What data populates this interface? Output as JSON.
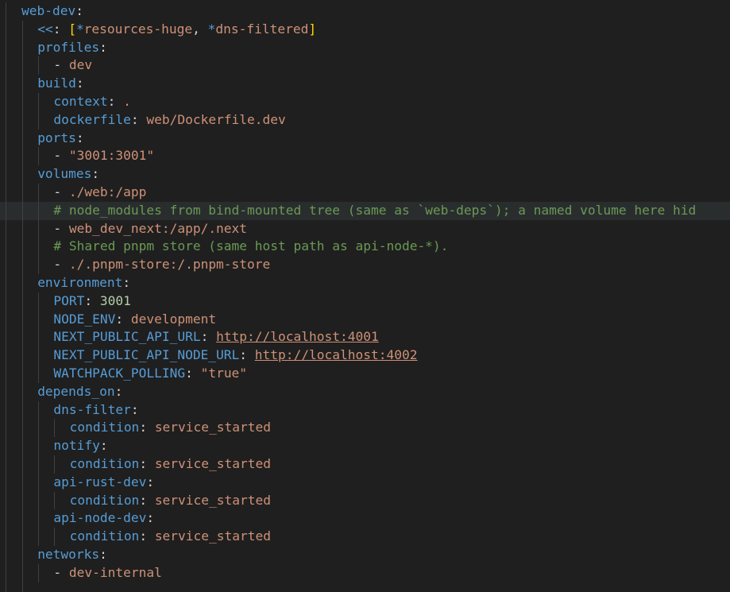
{
  "editor": {
    "lines": [
      {
        "indent": 1,
        "segments": [
          {
            "t": "k",
            "v": "web-dev"
          },
          {
            "t": "p",
            "v": ":"
          }
        ]
      },
      {
        "indent": 2,
        "segments": [
          {
            "t": "k",
            "v": "<<"
          },
          {
            "t": "p",
            "v": ": "
          },
          {
            "t": "b",
            "v": "["
          },
          {
            "t": "k",
            "v": "*"
          },
          {
            "t": "s",
            "v": "resources-huge"
          },
          {
            "t": "p",
            "v": ", "
          },
          {
            "t": "k",
            "v": "*"
          },
          {
            "t": "s",
            "v": "dns-filtered"
          },
          {
            "t": "b",
            "v": "]"
          }
        ]
      },
      {
        "indent": 2,
        "segments": [
          {
            "t": "k",
            "v": "profiles"
          },
          {
            "t": "p",
            "v": ":"
          }
        ]
      },
      {
        "indent": 3,
        "segments": [
          {
            "t": "p",
            "v": "- "
          },
          {
            "t": "s",
            "v": "dev"
          }
        ]
      },
      {
        "indent": 2,
        "segments": [
          {
            "t": "k",
            "v": "build"
          },
          {
            "t": "p",
            "v": ":"
          }
        ]
      },
      {
        "indent": 3,
        "segments": [
          {
            "t": "k",
            "v": "context"
          },
          {
            "t": "p",
            "v": ": "
          },
          {
            "t": "s",
            "v": "."
          }
        ]
      },
      {
        "indent": 3,
        "segments": [
          {
            "t": "k",
            "v": "dockerfile"
          },
          {
            "t": "p",
            "v": ": "
          },
          {
            "t": "s",
            "v": "web/Dockerfile.dev"
          }
        ]
      },
      {
        "indent": 2,
        "segments": [
          {
            "t": "k",
            "v": "ports"
          },
          {
            "t": "p",
            "v": ":"
          }
        ]
      },
      {
        "indent": 3,
        "segments": [
          {
            "t": "p",
            "v": "- "
          },
          {
            "t": "s",
            "v": "\"3001:3001\""
          }
        ]
      },
      {
        "indent": 2,
        "segments": [
          {
            "t": "k",
            "v": "volumes"
          },
          {
            "t": "p",
            "v": ":"
          }
        ]
      },
      {
        "indent": 3,
        "segments": [
          {
            "t": "p",
            "v": "- "
          },
          {
            "t": "s",
            "v": "./web:/app"
          }
        ]
      },
      {
        "indent": 3,
        "highlight": true,
        "segments": [
          {
            "t": "c",
            "v": "# node_modules from bind-mounted tree (same as `web-deps`); a named volume here hid"
          }
        ]
      },
      {
        "indent": 3,
        "segments": [
          {
            "t": "p",
            "v": "- "
          },
          {
            "t": "s",
            "v": "web_dev_next:/app/.next"
          }
        ]
      },
      {
        "indent": 3,
        "segments": [
          {
            "t": "c",
            "v": "# Shared pnpm store (same host path as api-node-*)."
          }
        ]
      },
      {
        "indent": 3,
        "segments": [
          {
            "t": "p",
            "v": "- "
          },
          {
            "t": "s",
            "v": "./.pnpm-store:/.pnpm-store"
          }
        ]
      },
      {
        "indent": 2,
        "segments": [
          {
            "t": "k",
            "v": "environment"
          },
          {
            "t": "p",
            "v": ":"
          }
        ]
      },
      {
        "indent": 3,
        "segments": [
          {
            "t": "k",
            "v": "PORT"
          },
          {
            "t": "p",
            "v": ": "
          },
          {
            "t": "n",
            "v": "3001"
          }
        ]
      },
      {
        "indent": 3,
        "segments": [
          {
            "t": "k",
            "v": "NODE_ENV"
          },
          {
            "t": "p",
            "v": ": "
          },
          {
            "t": "s",
            "v": "development"
          }
        ]
      },
      {
        "indent": 3,
        "segments": [
          {
            "t": "k",
            "v": "NEXT_PUBLIC_API_URL"
          },
          {
            "t": "p",
            "v": ": "
          },
          {
            "t": "u",
            "v": "http://localhost:4001"
          }
        ]
      },
      {
        "indent": 3,
        "segments": [
          {
            "t": "k",
            "v": "NEXT_PUBLIC_API_NODE_URL"
          },
          {
            "t": "p",
            "v": ": "
          },
          {
            "t": "u",
            "v": "http://localhost:4002"
          }
        ]
      },
      {
        "indent": 3,
        "segments": [
          {
            "t": "k",
            "v": "WATCHPACK_POLLING"
          },
          {
            "t": "p",
            "v": ": "
          },
          {
            "t": "s",
            "v": "\"true\""
          }
        ]
      },
      {
        "indent": 2,
        "segments": [
          {
            "t": "k",
            "v": "depends_on"
          },
          {
            "t": "p",
            "v": ":"
          }
        ]
      },
      {
        "indent": 3,
        "segments": [
          {
            "t": "k",
            "v": "dns-filter"
          },
          {
            "t": "p",
            "v": ":"
          }
        ]
      },
      {
        "indent": 4,
        "segments": [
          {
            "t": "k",
            "v": "condition"
          },
          {
            "t": "p",
            "v": ": "
          },
          {
            "t": "s",
            "v": "service_started"
          }
        ]
      },
      {
        "indent": 3,
        "segments": [
          {
            "t": "k",
            "v": "notify"
          },
          {
            "t": "p",
            "v": ":"
          }
        ]
      },
      {
        "indent": 4,
        "segments": [
          {
            "t": "k",
            "v": "condition"
          },
          {
            "t": "p",
            "v": ": "
          },
          {
            "t": "s",
            "v": "service_started"
          }
        ]
      },
      {
        "indent": 3,
        "segments": [
          {
            "t": "k",
            "v": "api-rust-dev"
          },
          {
            "t": "p",
            "v": ":"
          }
        ]
      },
      {
        "indent": 4,
        "segments": [
          {
            "t": "k",
            "v": "condition"
          },
          {
            "t": "p",
            "v": ": "
          },
          {
            "t": "s",
            "v": "service_started"
          }
        ]
      },
      {
        "indent": 3,
        "segments": [
          {
            "t": "k",
            "v": "api-node-dev"
          },
          {
            "t": "p",
            "v": ":"
          }
        ]
      },
      {
        "indent": 4,
        "segments": [
          {
            "t": "k",
            "v": "condition"
          },
          {
            "t": "p",
            "v": ": "
          },
          {
            "t": "s",
            "v": "service_started"
          }
        ]
      },
      {
        "indent": 2,
        "segments": [
          {
            "t": "k",
            "v": "networks"
          },
          {
            "t": "p",
            "v": ":"
          }
        ]
      },
      {
        "indent": 3,
        "segments": [
          {
            "t": "p",
            "v": "- "
          },
          {
            "t": "s",
            "v": "dev-internal"
          }
        ]
      },
      {
        "indent": 2,
        "segments": []
      }
    ]
  },
  "theme": {
    "background": "#1f1f1f",
    "key": "#569cd6",
    "string": "#ce9178",
    "comment": "#6a9955",
    "number": "#b5cea8",
    "bracket": "#ffd700",
    "punctuation": "#d4d4d4",
    "indent_guide": "#404040"
  }
}
